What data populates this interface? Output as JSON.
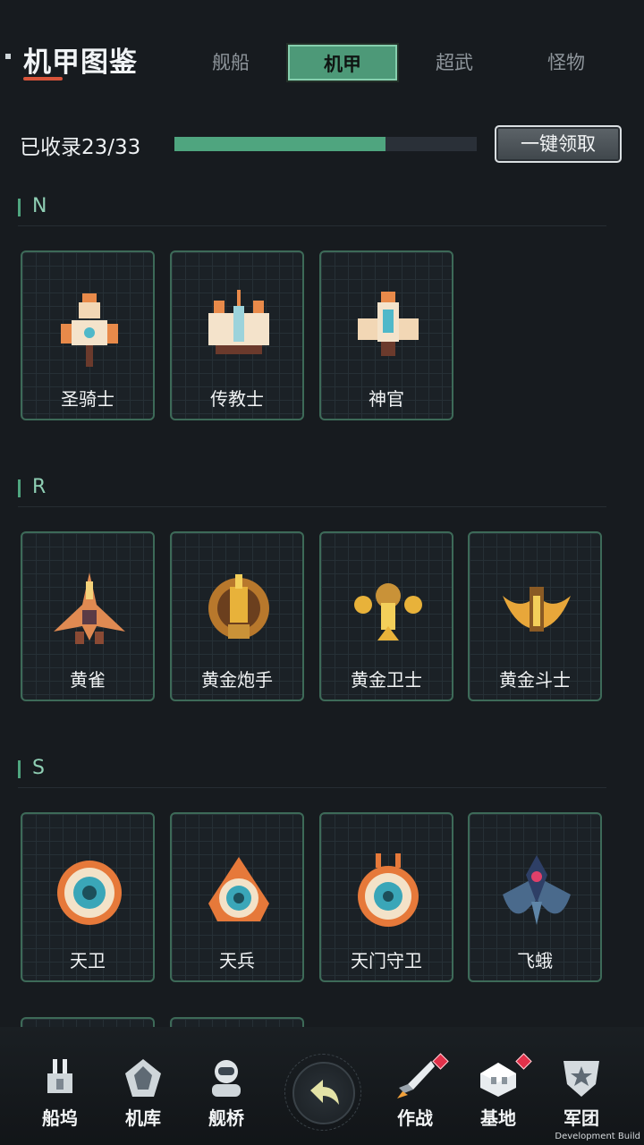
{
  "header": {
    "title": "机甲图鉴",
    "tabs": [
      {
        "label": "舰船",
        "active": false
      },
      {
        "label": "机甲",
        "active": true
      },
      {
        "label": "超武",
        "active": false
      },
      {
        "label": "怪物",
        "active": false
      }
    ]
  },
  "progress": {
    "label": "已收录23/33",
    "collected": 23,
    "total": 33,
    "claim_label": "一键领取"
  },
  "sections": [
    {
      "rarity": "N",
      "items": [
        "圣骑士",
        "传教士",
        "神官"
      ]
    },
    {
      "rarity": "R",
      "items": [
        "黄雀",
        "黄金炮手",
        "黄金卫士",
        "黄金斗士"
      ]
    },
    {
      "rarity": "S",
      "items": [
        "天卫",
        "天兵",
        "天门守卫",
        "飞蛾"
      ]
    }
  ],
  "nav": {
    "items": [
      {
        "label": "船坞",
        "icon": "dock-ship-icon"
      },
      {
        "label": "机库",
        "icon": "hangar-mech-icon"
      },
      {
        "label": "舰桥",
        "icon": "bridge-astronaut-icon"
      },
      {
        "label": "作战",
        "icon": "battle-rocket-icon",
        "badge": true
      },
      {
        "label": "基地",
        "icon": "base-building-icon",
        "badge": true
      },
      {
        "label": "军团",
        "icon": "legion-emblem-icon"
      }
    ],
    "back_icon": "back-arrow-icon"
  },
  "footer": {
    "build_label": "Development Build"
  },
  "colors": {
    "accent": "#4fa57f",
    "card_border": "#3d6a58",
    "badge": "#e2314a",
    "title_underline": "#d8543a"
  }
}
